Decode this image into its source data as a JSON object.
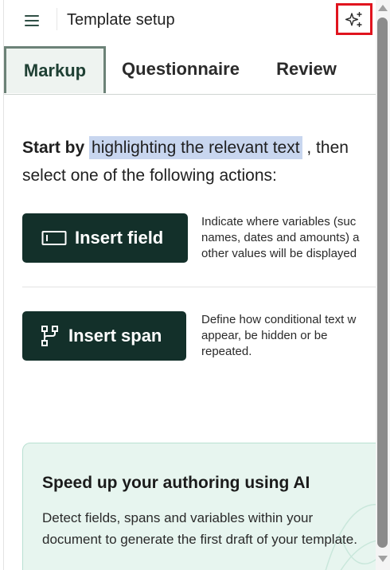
{
  "header": {
    "title": "Template setup",
    "menu_icon": "hamburger-menu-icon",
    "ai_icon": "sparkle-icon",
    "ai_highlight_color": "#e0141e"
  },
  "tabs": [
    {
      "label": "Markup",
      "active": true
    },
    {
      "label": "Questionnaire",
      "active": false
    },
    {
      "label": "Review",
      "active": false
    }
  ],
  "instructions": {
    "lead": "Start by",
    "highlight": "highlighting the relevant text",
    "after": ", then",
    "line2": "select one of the following actions:"
  },
  "actions": [
    {
      "label": "Insert field",
      "icon": "text-field-icon",
      "description": [
        "Indicate where variables (suc",
        "names, dates and amounts) a",
        "other values will be displayed"
      ]
    },
    {
      "label": "Insert span",
      "icon": "branch-icon",
      "description": [
        "Define how conditional text w",
        "appear, be hidden or be",
        "repeated."
      ]
    }
  ],
  "ai_card": {
    "title": "Speed up your authoring using AI",
    "body": "Detect fields, spans and variables within your document to generate the first draft of your template."
  },
  "colors": {
    "button_bg": "#13302a",
    "active_tab_border": "#6c8277",
    "highlight": "#c8d6ef",
    "card_bg": "#e7f5ef"
  }
}
